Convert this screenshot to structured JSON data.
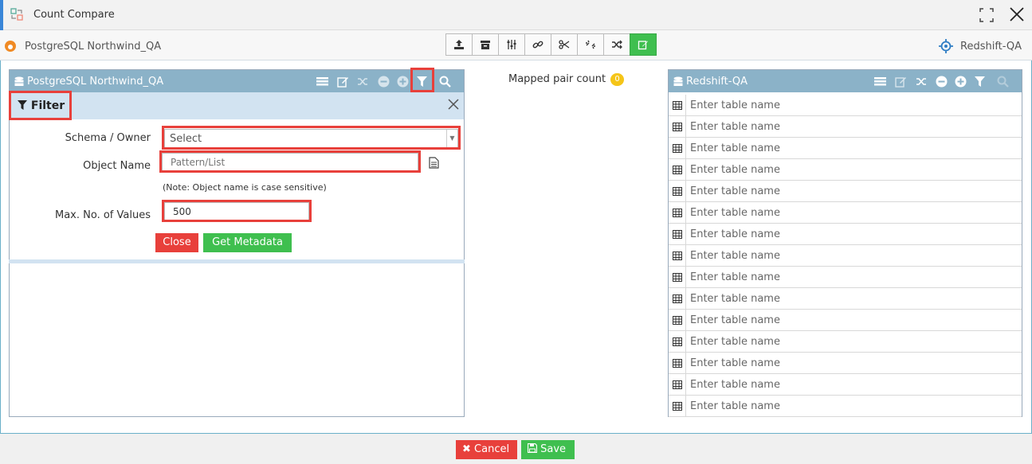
{
  "window": {
    "title": "Count Compare"
  },
  "connections": {
    "source": "PostgreSQL Northwind_QA",
    "target": "Redshift-QA"
  },
  "left_panel": {
    "title": "PostgreSQL Northwind_QA",
    "filter": {
      "heading": "Filter",
      "schema_label": "Schema / Owner",
      "schema_value": "Select",
      "object_label": "Object Name",
      "object_placeholder": "Pattern/List",
      "note": "(Note: Object name is case sensitive)",
      "max_label": "Max. No. of Values",
      "max_value": "500",
      "close_label": "Close",
      "metadata_label": "Get Metadata"
    }
  },
  "middle": {
    "mapped_label": "Mapped pair count",
    "mapped_count": "0"
  },
  "right_panel": {
    "title": "Redshift-QA",
    "rows": [
      "Enter table name",
      "Enter table name",
      "Enter table name",
      "Enter table name",
      "Enter table name",
      "Enter table name",
      "Enter table name",
      "Enter table name",
      "Enter table name",
      "Enter table name",
      "Enter table name",
      "Enter table name",
      "Enter table name",
      "Enter table name",
      "Enter table name"
    ]
  },
  "footer": {
    "cancel_label": "Cancel",
    "save_label": "Save"
  },
  "colors": {
    "header": "#8bb2c8",
    "filter_bar": "#d2e3f1",
    "danger": "#e8403b",
    "success": "#3fbf4f",
    "badge": "#f5c518"
  }
}
